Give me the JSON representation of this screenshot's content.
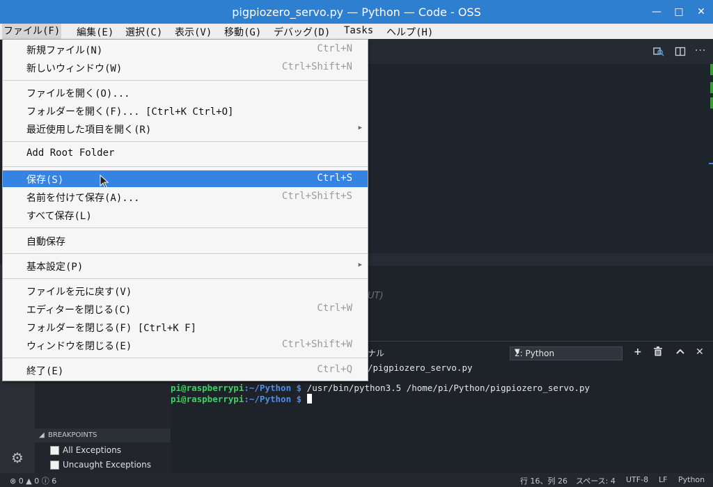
{
  "window": {
    "title": "pigpiozero_servo.py — Python — Code - OSS",
    "controls": {
      "minimize": "—",
      "maximize": "□",
      "close": "✕"
    }
  },
  "menubar": {
    "items": [
      "ファイル(F)",
      "編集(E)",
      "選択(C)",
      "表示(V)",
      "移動(G)",
      "デバッグ(D)",
      "Tasks",
      "ヘルプ(H)"
    ]
  },
  "file_menu": {
    "items": [
      {
        "label": "新規ファイル(N)",
        "shortcut": "Ctrl+N"
      },
      {
        "label": "新しいウィンドウ(W)",
        "shortcut": "Ctrl+Shift+N"
      },
      {
        "label": "ファイルを開く(O)...",
        "shortcut": ""
      },
      {
        "label": "フォルダーを開く(F)... [Ctrl+K Ctrl+O]",
        "shortcut": ""
      },
      {
        "label": "最近使用した項目を開く(R)",
        "shortcut": "",
        "submenu": true
      },
      {
        "label": "Add Root Folder",
        "shortcut": ""
      },
      {
        "label": "保存(S)",
        "shortcut": "Ctrl+S",
        "highlighted": true
      },
      {
        "label": "名前を付けて保存(A)...",
        "shortcut": "Ctrl+Shift+S"
      },
      {
        "label": "すべて保存(L)",
        "shortcut": ""
      },
      {
        "label": "自動保存",
        "shortcut": ""
      },
      {
        "label": "基本設定(P)",
        "shortcut": "",
        "submenu": true
      },
      {
        "label": "ファイルを元に戻す(V)",
        "shortcut": ""
      },
      {
        "label": "エディターを閉じる(C)",
        "shortcut": "Ctrl+W"
      },
      {
        "label": "フォルダーを閉じる(F) [Ctrl+K F]",
        "shortcut": ""
      },
      {
        "label": "ウィンドウを閉じる(E)",
        "shortcut": "Ctrl+Shift+W"
      },
      {
        "label": "終了(E)",
        "shortcut": "Ctrl+Q"
      }
    ]
  },
  "editor": {
    "output_hint": "UT)"
  },
  "panel": {
    "tab_label": "ナル",
    "terminal_select": "2: Python",
    "terminal_lines": {
      "line1_rest": "/pigpiozero_servo.py",
      "line2_user": "pi@raspberrypi",
      "line2_path": ":~/Python $",
      "line2_cmd": " /usr/bin/python3.5 /home/pi/Python/pigpiozero_servo.py",
      "line3_user": "pi@raspberrypi",
      "line3_path": ":~/Python $"
    }
  },
  "breakpoints": {
    "header": "BREAKPOINTS",
    "items": [
      "All Exceptions",
      "Uncaught Exceptions"
    ]
  },
  "statusbar": {
    "errors": "0",
    "warnings": "0",
    "info": "6",
    "position": "行 16、列 26",
    "spaces": "スペース: 4",
    "encoding": "UTF-8",
    "eol": "LF",
    "language": "Python"
  }
}
